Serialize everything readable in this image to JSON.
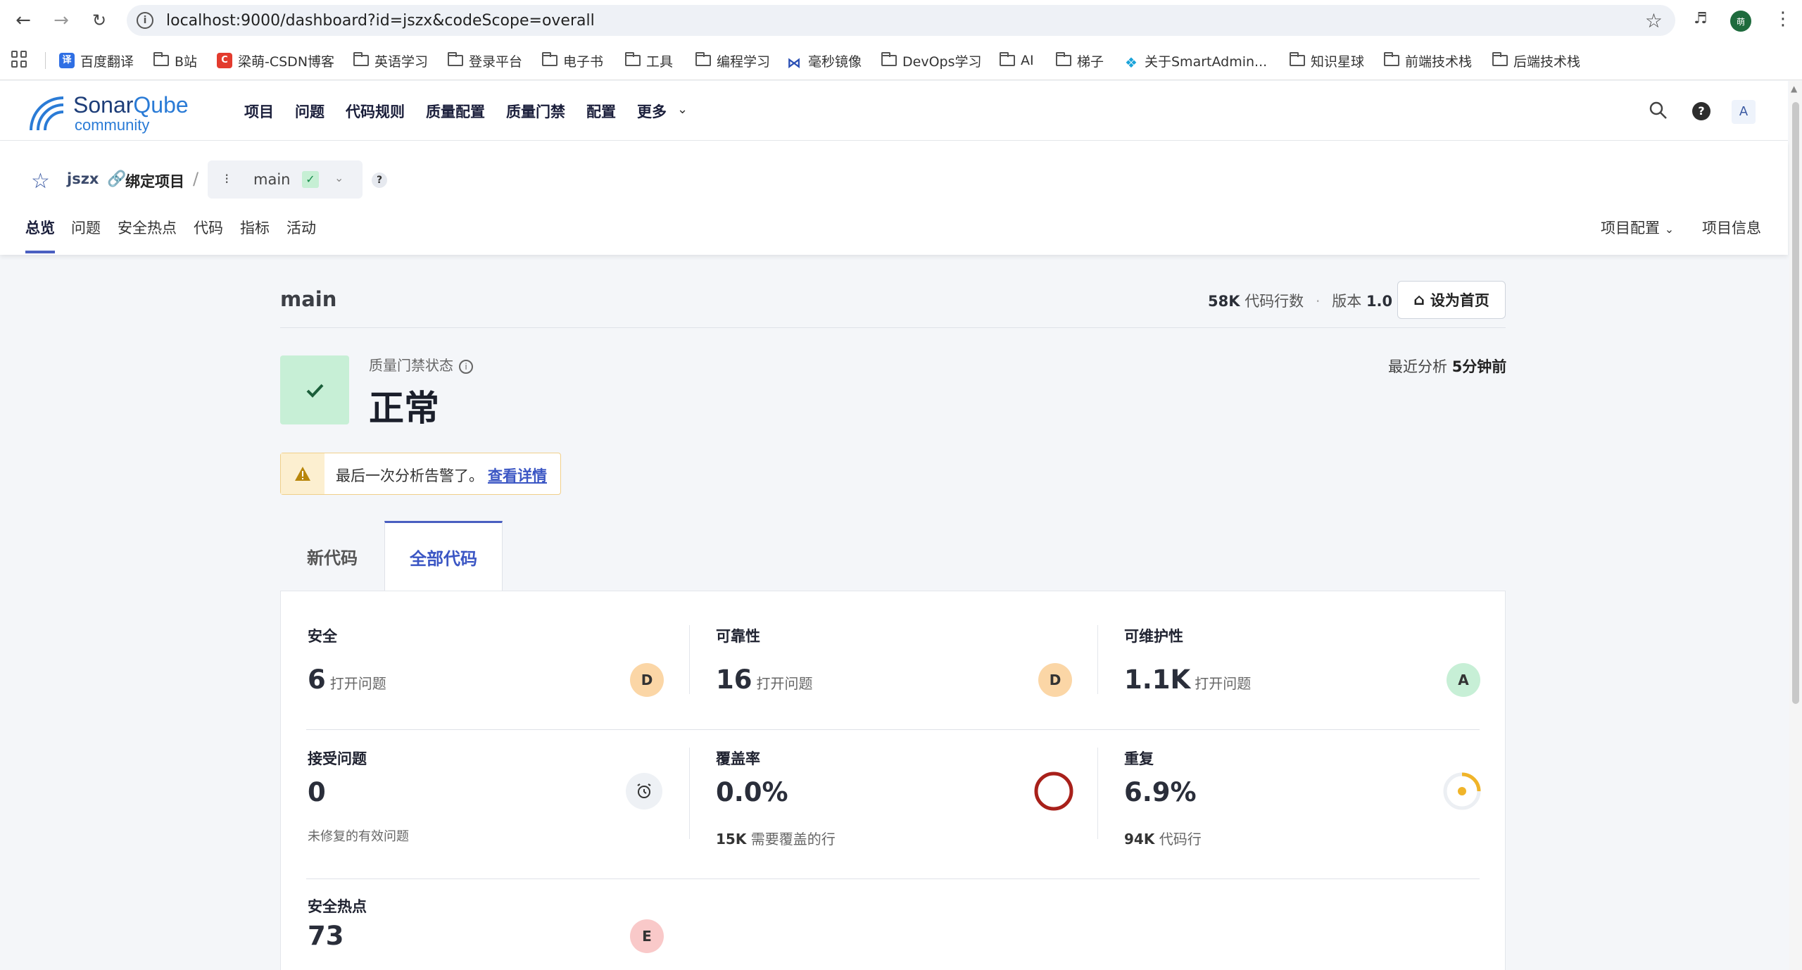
{
  "browser": {
    "url": "localhost:9000/dashboard?id=jszx&codeScope=overall",
    "profile_initial": "萌"
  },
  "bookmarks": [
    {
      "label": "百度翻译",
      "icon": "translate-icon"
    },
    {
      "label": "B站",
      "icon": "folder-icon"
    },
    {
      "label": "梁萌-CSDN博客",
      "icon": "csdn-icon"
    },
    {
      "label": "英语学习",
      "icon": "folder-icon"
    },
    {
      "label": "登录平台",
      "icon": "folder-icon"
    },
    {
      "label": "电子书",
      "icon": "folder-icon"
    },
    {
      "label": "工具",
      "icon": "folder-icon"
    },
    {
      "label": "编程学习",
      "icon": "folder-icon"
    },
    {
      "label": "毫秒镜像",
      "icon": "mirror-icon"
    },
    {
      "label": "DevOps学习",
      "icon": "folder-icon"
    },
    {
      "label": "AI",
      "icon": "folder-icon"
    },
    {
      "label": "梯子",
      "icon": "folder-icon"
    },
    {
      "label": "关于SmartAdmin...",
      "icon": "smartadmin-icon"
    },
    {
      "label": "知识星球",
      "icon": "folder-icon"
    },
    {
      "label": "前端技术栈",
      "icon": "folder-icon"
    },
    {
      "label": "后端技术栈",
      "icon": "folder-icon"
    }
  ],
  "header": {
    "logo_word1": "Sonar",
    "logo_word1b": "Qube",
    "logo_word2": "community",
    "nav": [
      "项目",
      "问题",
      "代码规则",
      "质量配置",
      "质量门禁",
      "配置",
      "更多"
    ],
    "user_initial": "A"
  },
  "project": {
    "name": "jszx",
    "bind_label": "绑定项目",
    "branch": "main",
    "tabs": [
      "总览",
      "问题",
      "安全热点",
      "代码",
      "指标",
      "活动"
    ],
    "config_label": "项目配置",
    "info_label": "项目信息"
  },
  "overview": {
    "title": "main",
    "loc_value": "58K",
    "loc_label": "代码行数",
    "version_label": "版本",
    "version_value": "1.0",
    "home_button": "设为首页",
    "qg_label": "质量门禁状态",
    "qg_status": "正常",
    "last_analysis_label": "最近分析",
    "last_analysis_value": "5分钟前",
    "warning_text": "最后一次分析告警了。",
    "warning_link": "查看详情",
    "tab_new": "新代码",
    "tab_all": "全部代码"
  },
  "metrics": {
    "security": {
      "title": "安全",
      "value": "6",
      "unit": "打开问题",
      "rating": "D"
    },
    "reliability": {
      "title": "可靠性",
      "value": "16",
      "unit": "打开问题",
      "rating": "D"
    },
    "maintainability": {
      "title": "可维护性",
      "value": "1.1K",
      "unit": "打开问题",
      "rating": "A"
    },
    "accepted": {
      "title": "接受问题",
      "value": "0",
      "sub": "未修复的有效问题"
    },
    "coverage": {
      "title": "覆盖率",
      "value": "0.0%",
      "sub_value": "15K",
      "sub_label": "需要覆盖的行",
      "percent": 0
    },
    "duplication": {
      "title": "重复",
      "value": "6.9%",
      "sub_value": "94K",
      "sub_label": "代码行",
      "percent": 6.9
    },
    "hotspots": {
      "title": "安全热点",
      "value": "73",
      "rating": "E"
    }
  },
  "colors": {
    "rating_A": "#c7efd6",
    "rating_D": "#fbd6a6",
    "rating_E": "#f9c9c9",
    "accent": "#4a5fc1",
    "coverage_ring": "#a8201a",
    "duplication_ring": "#f0b429"
  }
}
